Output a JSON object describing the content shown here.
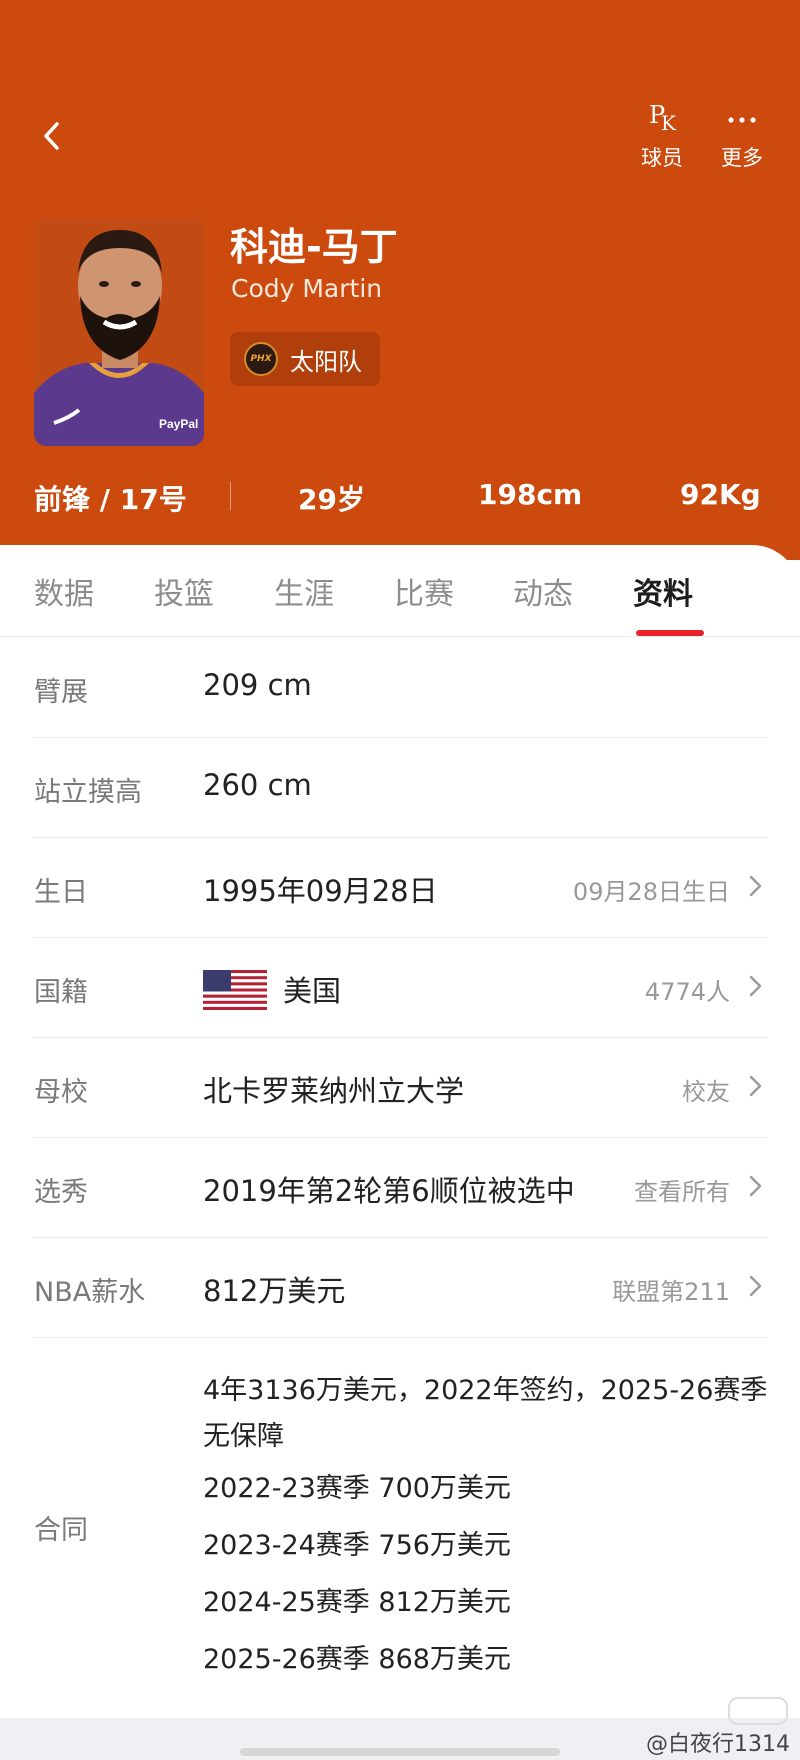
{
  "nav": {
    "back_icon": "chevron-left-icon",
    "actions": [
      {
        "label": "球员",
        "icon": "pk-icon"
      },
      {
        "label": "更多",
        "icon": "more-icon"
      }
    ]
  },
  "player": {
    "name_cn": "科迪-马丁",
    "name_en": "Cody Martin",
    "team": "太阳队",
    "team_logo_text": "PHX",
    "position_number": "前锋 / 17号",
    "age": "29岁",
    "height": "198cm",
    "weight": "92Kg"
  },
  "tabs": [
    {
      "label": "数据",
      "active": false
    },
    {
      "label": "投篮",
      "active": false
    },
    {
      "label": "生涯",
      "active": false
    },
    {
      "label": "比赛",
      "active": false
    },
    {
      "label": "动态",
      "active": false
    },
    {
      "label": "资料",
      "active": true
    }
  ],
  "info": {
    "wingspan": {
      "label": "臂展",
      "value": "209 cm"
    },
    "reach": {
      "label": "站立摸高",
      "value": "260 cm"
    },
    "birthday": {
      "label": "生日",
      "value": "1995年09月28日",
      "extra": "09月28日生日"
    },
    "nationality": {
      "label": "国籍",
      "value": "美国",
      "extra": "4774人"
    },
    "college": {
      "label": "母校",
      "value": "北卡罗莱纳州立大学",
      "extra": "校友"
    },
    "draft": {
      "label": "选秀",
      "value": "2019年第2轮第6顺位被选中",
      "extra": "查看所有"
    },
    "salary": {
      "label": "NBA薪水",
      "value": "812万美元",
      "extra": "联盟第211"
    },
    "contract": {
      "label": "合同",
      "summary": "4年3136万美元，2022年签约，2025-26赛季无保障",
      "seasons": [
        "2022-23赛季 700万美元",
        "2023-24赛季 756万美元",
        "2024-25赛季 812万美元",
        "2025-26赛季 868万美元"
      ]
    }
  },
  "watermark": "@白夜行1314",
  "colors": {
    "header_bg": "#cc4a0e",
    "tab_accent": "#e8212b"
  }
}
